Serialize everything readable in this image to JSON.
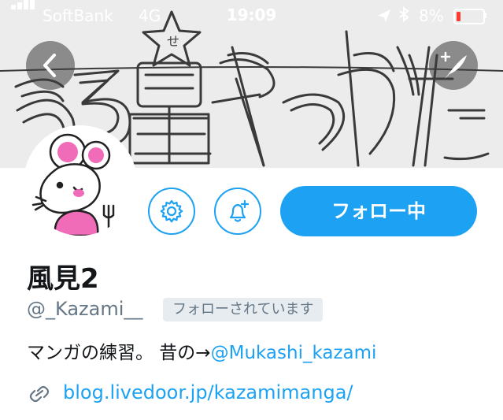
{
  "status_bar": {
    "carrier": "SoftBank",
    "network": "4G",
    "time": "19:09",
    "battery_percent_text": "8%",
    "battery_level": 0.08,
    "battery_color": "#ff3b30"
  },
  "header": {
    "back_icon": "chevron-left-icon",
    "compose_icon": "compose-tweet-icon"
  },
  "profile": {
    "display_name": "風見2",
    "handle": "@_Kazami__",
    "follows_you_badge": "フォローされています",
    "bio_text": "マンガの練習。 昔の→",
    "bio_mention": "@Mukashi_kazami",
    "website": "blog.livedoor.jp/kazamimanga/",
    "avatar_icon": "mouse-avatar-icon"
  },
  "actions": {
    "settings_icon": "gear-icon",
    "notifications_icon": "bell-plus-icon",
    "follow_label": "フォロー中"
  },
  "colors": {
    "accent": "#1da1f2",
    "text_primary": "#14171a",
    "text_secondary": "#657786",
    "badge_bg": "#e6ecf0"
  }
}
